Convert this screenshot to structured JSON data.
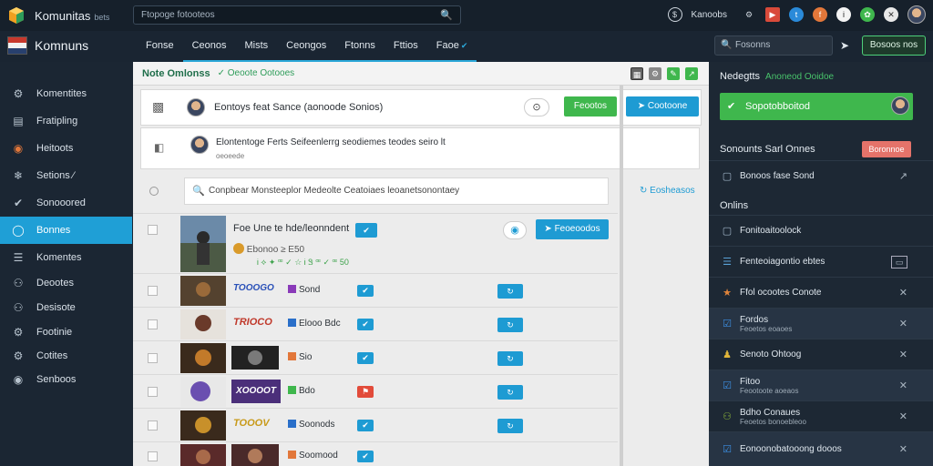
{
  "app": {
    "title": "Komunitas",
    "subtitle": "bets",
    "brand": "Komnuns"
  },
  "search": {
    "placeholder": "Ftopoge fotooteos"
  },
  "top": {
    "label": "Kanoobs"
  },
  "tabs": [
    {
      "label": "Fonse"
    },
    {
      "label": "Ceonos"
    },
    {
      "label": "Mists"
    },
    {
      "label": "Ceongos"
    },
    {
      "label": "Ftonns"
    },
    {
      "label": "Fttios"
    },
    {
      "label": "Faoe"
    }
  ],
  "right_search": {
    "placeholder": "Fosonns"
  },
  "right_button": {
    "label": "Bosoos nos"
  },
  "sidebar": {
    "items": [
      {
        "label": "Komentites",
        "icon": "gear-icon"
      },
      {
        "label": "Fratipling",
        "icon": "chart-icon"
      },
      {
        "label": "Heitoots",
        "icon": "fire-icon"
      },
      {
        "label": "Setions ⁄",
        "icon": "compass-icon"
      },
      {
        "label": "Sonooored",
        "icon": "check-icon"
      },
      {
        "label": "Bonnes",
        "icon": "circle-icon"
      },
      {
        "label": "Komentes",
        "icon": "list-icon"
      },
      {
        "label": "Deootes",
        "icon": "people-icon"
      },
      {
        "label": "Desisote",
        "icon": "users-icon"
      },
      {
        "label": "Footinie",
        "icon": "settings-icon"
      },
      {
        "label": "Cotites",
        "icon": "gear-icon"
      },
      {
        "label": "Senboos",
        "icon": "globe-icon"
      }
    ]
  },
  "main": {
    "heading": "Note Omlonss",
    "heading_sub": "Oeoote Ootooes",
    "post1": {
      "text": "Eontoys feat Sance (aonoode Sonios)",
      "badge": "⊙",
      "btn_green": "Feootos",
      "btn_blue": "Cootoone"
    },
    "post2": {
      "title": "Elontentoge Ferts Seifeenlerrg seodiemes teodes seiro lt",
      "sub": "oeoeede"
    },
    "composer": {
      "placeholder": "Conpbear Monsteeplor Medeolte Ceatoiaes leoanetsonontaey",
      "action": "Eosheasos"
    },
    "featured": {
      "title": "Foe Une te hde/leonndent",
      "meta": "Ebonoo ≥ E50",
      "ticks": "Ꭵ ⟡ ✦ ꟹ ✓ ☆ Ꭵ Ꮥ ꟹ ✓ ꟹ 50",
      "btn": "Feoeoodos"
    },
    "rows": [
      {
        "label": "Sond",
        "color": "#8a3ab9"
      },
      {
        "label": "Elooo Bdc",
        "color": "#2a6fc9"
      },
      {
        "label": "Sio",
        "color": "#e2773a"
      },
      {
        "label": "Bdo",
        "color": "#3fb74d"
      },
      {
        "label": "Soonods",
        "color": "#2a6fc9"
      },
      {
        "label": "Soomood",
        "color": "#e2773a"
      }
    ],
    "row_banners": [
      "TOOOGO",
      "TRIOCO",
      "",
      "XOOOOT",
      "TOOOV",
      ""
    ]
  },
  "rpanel": {
    "head": "Nedegtts",
    "head_sub": "Anoneod Ooidoe",
    "green": "Sopotobboitod",
    "section1": "Sonounts Sarl Onnes",
    "section1_badge": "Boronnoe",
    "item0": "Bonoos fase Sond",
    "section2": "Onlins",
    "items": [
      {
        "label": "Fonitoaitoolock",
        "sub": "",
        "icon": "square-icon",
        "color": "#9fb3c6"
      },
      {
        "label": "Fenteoiagontio ebtes",
        "sub": "",
        "icon": "list-icon",
        "color": "#5aa2d8"
      },
      {
        "label": "Ffol ocootes Conote",
        "sub": "",
        "icon": "star-icon",
        "color": "#e0843a"
      },
      {
        "label": "Fordos",
        "sub": "Feoetos eoaoes",
        "icon": "check-icon",
        "color": "#3b8ee0"
      },
      {
        "label": "Senoto Ohtoog",
        "sub": "",
        "icon": "person-icon",
        "color": "#e0b53a"
      },
      {
        "label": "Fitoo",
        "sub": "Feootoote aoeaos",
        "icon": "check-icon",
        "color": "#3b8ee0"
      },
      {
        "label": "Bdho Conaues",
        "sub": "Feoetos bonoebleoo",
        "icon": "users-icon",
        "color": "#8ab43a"
      },
      {
        "label": "Eonoonobatooong dooos",
        "sub": "",
        "icon": "check-icon",
        "color": "#3b8ee0"
      }
    ]
  },
  "colors": {
    "accent": "#1f9fd6",
    "green": "#3fb74d",
    "panel_dark": "#1d2834"
  }
}
